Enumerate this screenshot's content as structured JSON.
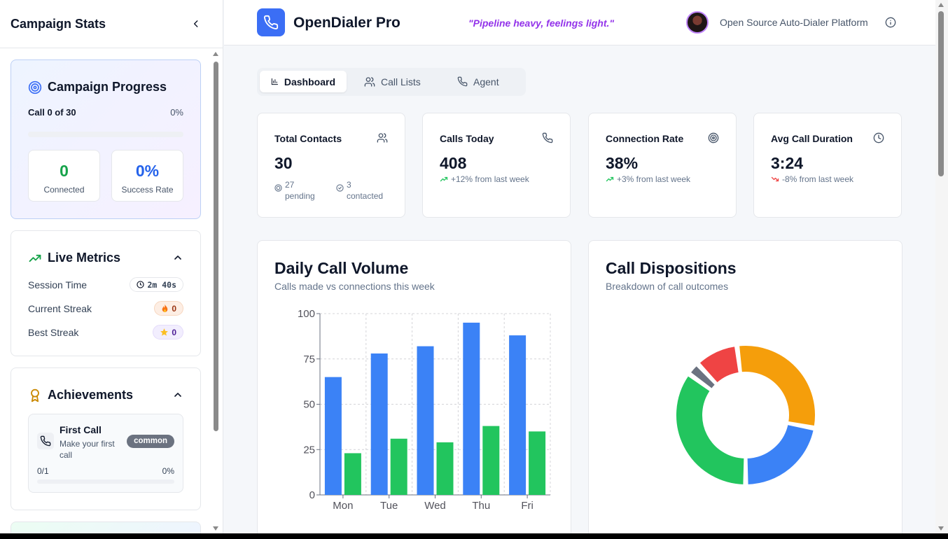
{
  "sidebar": {
    "title": "Campaign Stats",
    "progress": {
      "title": "Campaign Progress",
      "call_label": "Call 0 of 30",
      "percent_label": "0%",
      "percent_value": 0,
      "connected_value": "0",
      "connected_label": "Connected",
      "success_value": "0%",
      "success_label": "Success Rate"
    },
    "live_metrics": {
      "title": "Live Metrics",
      "session_label": "Session Time",
      "session_value": "2m 40s",
      "streak_label": "Current Streak",
      "streak_value": "0",
      "best_label": "Best Streak",
      "best_value": "0"
    },
    "achievements": {
      "title": "Achievements",
      "item_name": "First Call",
      "item_desc": "Make your first call",
      "item_rarity": "common",
      "item_progress": "0/1",
      "item_percent": "0%"
    }
  },
  "header": {
    "brand": "OpenDialer Pro",
    "tagline": "\"Pipeline heavy, feelings light.\"",
    "platform": "Open Source Auto-Dialer Platform"
  },
  "tabs": [
    {
      "label": "Dashboard",
      "active": true
    },
    {
      "label": "Call Lists",
      "active": false
    },
    {
      "label": "Agent",
      "active": false
    }
  ],
  "stats": {
    "contacts": {
      "title": "Total Contacts",
      "value": "30",
      "pending": "27 pending",
      "contacted": "3 contacted"
    },
    "calls": {
      "title": "Calls Today",
      "value": "408",
      "delta": "+12% from last week"
    },
    "connection": {
      "title": "Connection Rate",
      "value": "38%",
      "delta": "+3% from last week"
    },
    "duration": {
      "title": "Avg Call Duration",
      "value": "3:24",
      "delta": "-8% from last week"
    }
  },
  "colors": {
    "blue": "#3b82f6",
    "green": "#22c55e",
    "orange": "#f59e0b",
    "red": "#ef4444",
    "gray": "#6b7280",
    "accent": "#3b6ef5",
    "tagline": "#9333ea"
  },
  "volume_panel": {
    "title": "Daily Call Volume",
    "subtitle": "Calls made vs connections this week"
  },
  "dispositions_panel": {
    "title": "Call Dispositions",
    "subtitle": "Breakdown of call outcomes"
  },
  "chart_data": [
    {
      "type": "bar",
      "title": "Daily Call Volume",
      "categories": [
        "Mon",
        "Tue",
        "Wed",
        "Thu",
        "Fri"
      ],
      "ylim": [
        0,
        100
      ],
      "yticks": [
        0,
        25,
        50,
        75,
        100
      ],
      "grid": true,
      "series": [
        {
          "values": [
            65,
            78,
            82,
            95,
            88
          ],
          "color": "#3b82f6"
        },
        {
          "values": [
            23,
            31,
            29,
            38,
            35
          ],
          "color": "#22c55e"
        }
      ]
    },
    {
      "type": "pie",
      "title": "Call Dispositions",
      "donut": true,
      "slices": [
        {
          "value": 35,
          "color": "#22c55e"
        },
        {
          "value": 3,
          "color": "#6b7280"
        },
        {
          "value": 10,
          "color": "#ef4444"
        },
        {
          "value": 30,
          "color": "#f59e0b"
        },
        {
          "value": 22,
          "color": "#3b82f6"
        }
      ]
    }
  ]
}
